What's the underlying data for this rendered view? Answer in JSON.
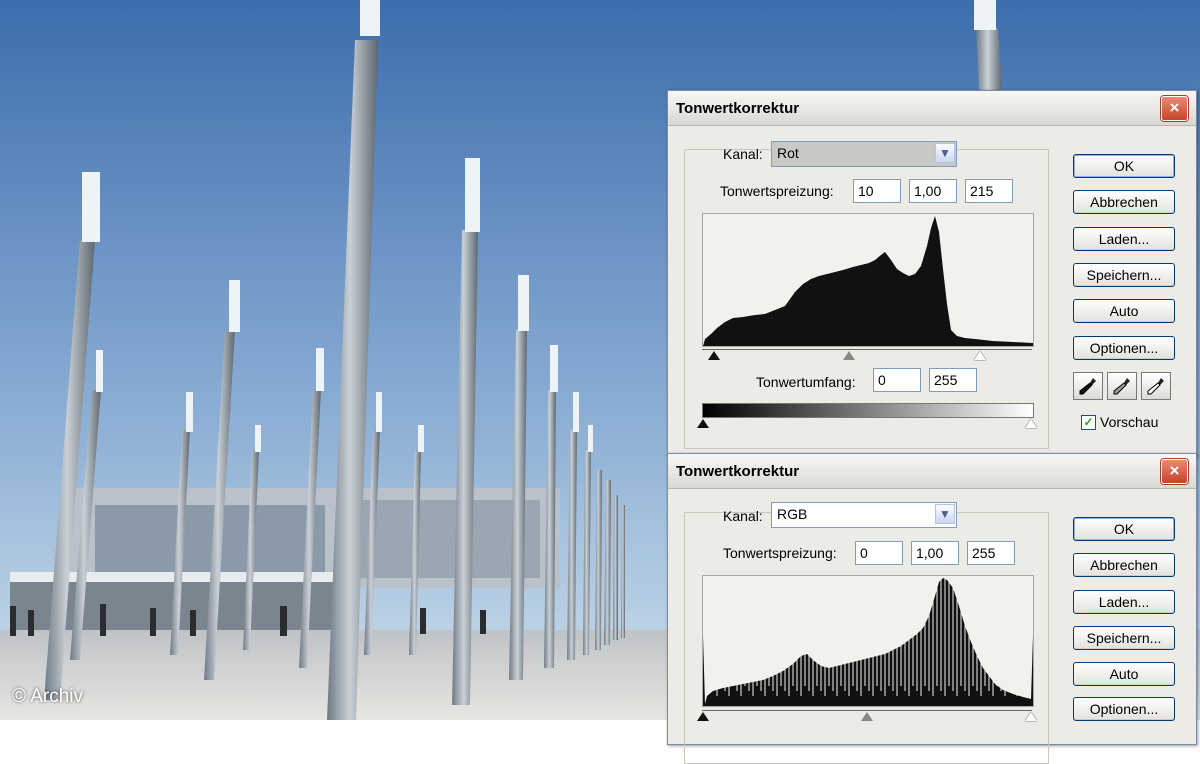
{
  "scene": {
    "credit": "© Archiv"
  },
  "dialog1": {
    "title": "Tonwertkorrektur",
    "close_glyph": "×",
    "channel_label": "Kanal:",
    "channel_value": "Rot",
    "input_levels_label": "Tonwertspreizung:",
    "input_black": "10",
    "input_gamma": "1,00",
    "input_white": "215",
    "output_levels_label": "Tonwertumfang:",
    "output_black": "0",
    "output_white": "255",
    "buttons": {
      "ok": "OK",
      "cancel": "Abbrechen",
      "load": "Laden...",
      "save": "Speichern...",
      "auto": "Auto",
      "options": "Optionen..."
    },
    "preview_label": "Vorschau",
    "preview_checked": true
  },
  "dialog2": {
    "title": "Tonwertkorrektur",
    "close_glyph": "×",
    "channel_label": "Kanal:",
    "channel_value": "RGB",
    "input_levels_label": "Tonwertspreizung:",
    "input_black": "0",
    "input_gamma": "1,00",
    "input_white": "255",
    "buttons": {
      "ok": "OK",
      "cancel": "Abbrechen",
      "load": "Laden...",
      "save": "Speichern...",
      "auto": "Auto",
      "options": "Optionen..."
    }
  },
  "colors": {
    "sky_top": "#3f6fae",
    "sky_bottom": "#c9dceb",
    "dialog_bg": "#ecebe6",
    "close_red": "#c8432a",
    "histogram": "#111111"
  }
}
